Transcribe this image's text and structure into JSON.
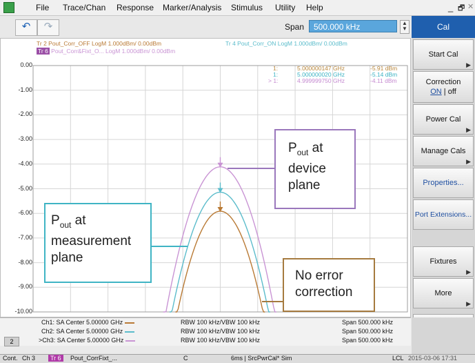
{
  "menu": [
    "File",
    "Trace/Chan",
    "Response",
    "Marker/Analysis",
    "Stimulus",
    "Utility",
    "Help"
  ],
  "window_controls": {
    "minimize": "_",
    "restore": "🗗",
    "close": "✕"
  },
  "toolbar": {
    "undo_icon": "undo-icon",
    "redo_icon": "redo-icon",
    "span_label": "Span",
    "span_value": "500.000 kHz"
  },
  "panel": {
    "title": "Cal",
    "buttons": {
      "start_cal": "Start Cal",
      "correction": "Correction",
      "correction_on": "ON",
      "correction_off": "off",
      "power_cal": "Power Cal",
      "manage_cals": "Manage Cals",
      "properties": "Properties...",
      "port_extensions": "Port Extensions...",
      "fixtures": "Fixtures",
      "more": "More"
    }
  },
  "traces": {
    "tr2": "Tr 2  Pout_Corr_OFF LogM 1.000dBm/ 0.00dBm",
    "tr4": "Tr 4  Pout_Corr_ON LogM 1.000dBm/ 0.00dBm",
    "tr6_badge": "Tr 6",
    "tr6": "Pout_Corr&Fixt_O...  LogM 1.000dBm/ 0.00dBm"
  },
  "markers": [
    {
      "id": "1:",
      "freq": "5.000000147 GHz",
      "value": "-5.91 dBm",
      "color": "#b8863b"
    },
    {
      "id": "1:",
      "freq": "5.000000020 GHz",
      "value": "-5.14 dBm",
      "color": "#3bb3c3"
    },
    {
      "id": "> 1:",
      "freq": "4.999999750 GHz",
      "value": "-4.11 dBm",
      "color": "#c58ad0"
    }
  ],
  "y_ticks": [
    "0.00",
    "-1.00",
    "-2.00",
    "-3.00",
    "-4.00",
    "-5.00",
    "-6.00",
    "-7.00",
    "-8.00",
    "-9.00",
    "-10.00"
  ],
  "chart_data": {
    "type": "line",
    "ylim": [
      -10,
      0
    ],
    "yunit": "dBm",
    "series": [
      {
        "name": "Pout_Corr_OFF",
        "color": "#b97a35",
        "peak": -5.91
      },
      {
        "name": "Pout_Corr_ON",
        "color": "#5bbccb",
        "peak": -5.14
      },
      {
        "name": "Pout_Corr&Fixt_O...",
        "color": "#c994d4",
        "peak": -4.11
      }
    ]
  },
  "callouts": {
    "device_pre": "P",
    "device_sub": "out",
    "device_post": " at",
    "device_2": "device",
    "device_3": "plane",
    "meas_pre": "P",
    "meas_sub": "out",
    "meas_post": " at",
    "meas_2": "measurement",
    "meas_3": "plane",
    "noerr_1": "No error",
    "noerr_2": "correction"
  },
  "channels": [
    {
      "label": "Ch1: SA Center  5.00000 GHz",
      "line_color": "#b97a35",
      "rbw": "RBW  100 kHz/VBW  100 kHz",
      "span": "Span  500.000 kHz"
    },
    {
      "label": "Ch2: SA Center  5.00000 GHz",
      "line_color": "#5bbccb",
      "rbw": "RBW  100 kHz/VBW  100 kHz",
      "span": "Span  500.000 kHz"
    },
    {
      "label": ">Ch3: SA Center  5.00000 GHz",
      "line_color": "#c994d4",
      "rbw": "RBW  100 kHz/VBW  100 kHz",
      "span": "Span  500.000 kHz"
    }
  ],
  "channel_number": "2",
  "status": {
    "cont": "Cont.",
    "ch": "Ch 3",
    "tr": "Tr 6",
    "trace": "Pout_CorrFixt_...",
    "c": "C",
    "sweep": "6ms | SrcPwrCal* Sim",
    "lcl": "LCL",
    "datetime": "2015-03-06 17:31"
  }
}
